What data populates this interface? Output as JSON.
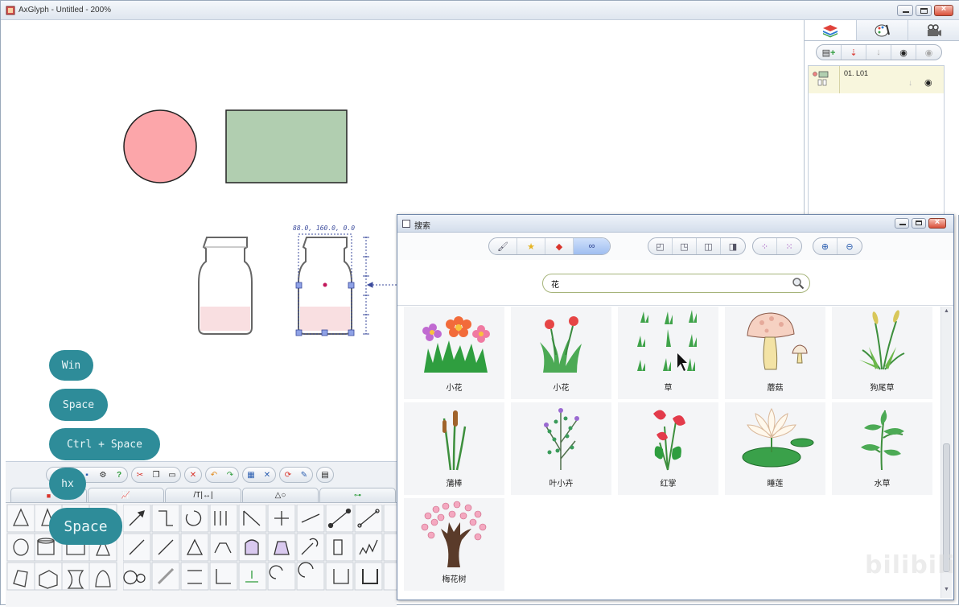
{
  "window": {
    "title": "AxGlyph - Untitled - 200%"
  },
  "canvas": {
    "coord_readout": "88.0, 160.0, 0.0"
  },
  "layers_panel": {
    "layer_name": "01. L01"
  },
  "search_dialog": {
    "title": "搜索",
    "search_value": "花",
    "results": [
      {
        "label": "小花",
        "icon": "flower-bunch-icon"
      },
      {
        "label": "小花",
        "icon": "red-flowers-icon"
      },
      {
        "label": "草",
        "icon": "grass-tufts-icon"
      },
      {
        "label": "蘑菇",
        "icon": "mushroom-icon"
      },
      {
        "label": "狗尾草",
        "icon": "foxtail-grass-icon"
      },
      {
        "label": "蒲棒",
        "icon": "cattail-icon"
      },
      {
        "label": "叶小卉",
        "icon": "small-leaf-plant-icon"
      },
      {
        "label": "红掌",
        "icon": "anthurium-icon"
      },
      {
        "label": "睡莲",
        "icon": "water-lily-icon"
      },
      {
        "label": "水草",
        "icon": "water-weed-icon"
      },
      {
        "label": "梅花树",
        "icon": "plum-blossom-tree-icon"
      }
    ]
  },
  "bottom_panel": {
    "tabs": [
      "",
      "",
      "",
      "",
      ""
    ]
  },
  "key_overlays": [
    "Win",
    "Space",
    "Ctrl + Space",
    "hx",
    "Space"
  ],
  "watermark": "bilibili",
  "colors": {
    "circle_fill": "#fca6aa",
    "rect_fill": "#b1ceb0",
    "badge": "#2e8c99",
    "selection": "#3b4b9c"
  }
}
